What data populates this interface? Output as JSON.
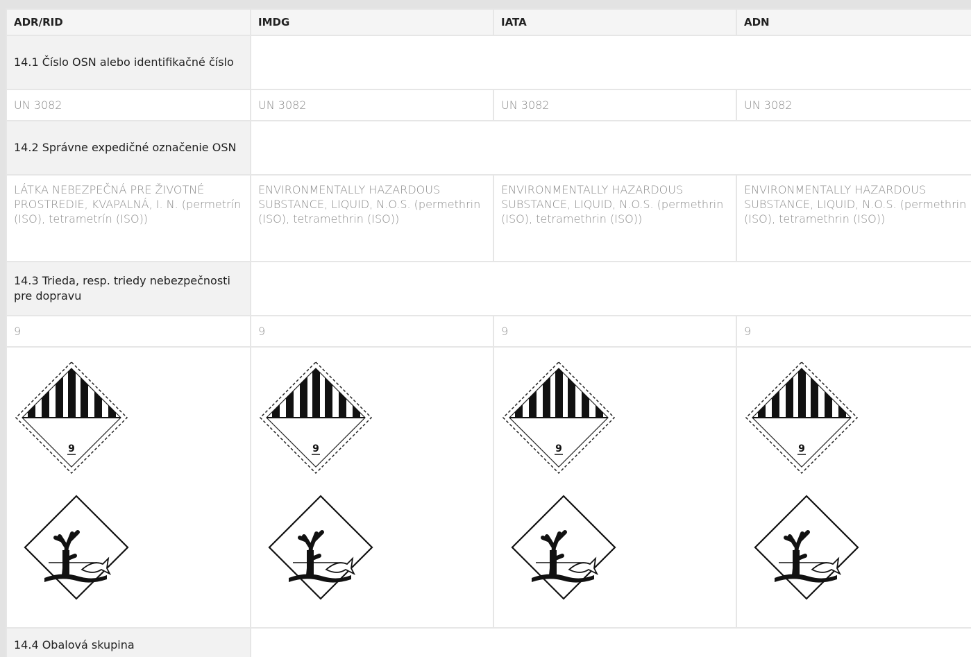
{
  "headers": [
    "ADR/RID",
    "IMDG",
    "IATA",
    "ADN"
  ],
  "sections": {
    "s1": "14.1 Číslo OSN alebo identifikačné číslo",
    "s2": "14.2 Správne expedičné označenie OSN",
    "s3": "14.3 Trieda, resp. triedy nebezpečnosti pre dopravu",
    "s4": "14.4 Obalová skupina"
  },
  "un_numbers": [
    "UN 3082",
    "UN 3082",
    "UN 3082",
    "UN 3082"
  ],
  "shipping_names": [
    "LÁTKA NEBEZPEČNÁ PRE ŽIVOTNÉ PROSTREDIE, KVAPALNÁ, I. N. (permetrín (ISO), tetrametrín (ISO))",
    "ENVIRONMENTALLY HAZARDOUS SUBSTANCE, LIQUID, N.O.S. (permethrin (ISO), tetramethrin (ISO))",
    "ENVIRONMENTALLY HAZARDOUS SUBSTANCE, LIQUID, N.O.S. (permethrin (ISO), tetramethrin (ISO))",
    "ENVIRONMENTALLY HAZARDOUS SUBSTANCE, LIQUID, N.O.S. (permethrin (ISO), tetramethrin (ISO))"
  ],
  "hazard_classes": [
    "9",
    "9",
    "9",
    "9"
  ],
  "pictograms": {
    "class_label_icon": "class-9-hazard-label-icon",
    "class_label_number": "9",
    "environment_icon": "environmentally-hazardous-substance-mark-icon"
  }
}
